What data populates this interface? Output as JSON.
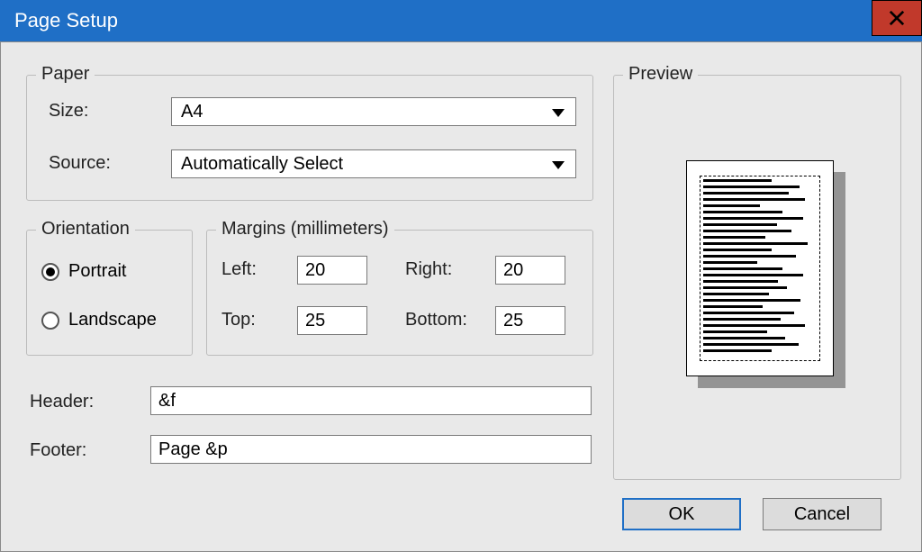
{
  "window": {
    "title": "Page Setup"
  },
  "paper": {
    "legend": "Paper",
    "size_label": "Size:",
    "size_value": "A4",
    "source_label": "Source:",
    "source_value": "Automatically Select"
  },
  "orientation": {
    "legend": "Orientation",
    "portrait_label": "Portrait",
    "landscape_label": "Landscape",
    "selected": "portrait"
  },
  "margins": {
    "legend": "Margins (millimeters)",
    "left_label": "Left:",
    "left_value": "20",
    "right_label": "Right:",
    "right_value": "20",
    "top_label": "Top:",
    "top_value": "25",
    "bottom_label": "Bottom:",
    "bottom_value": "25"
  },
  "header": {
    "label": "Header:",
    "value": "&f"
  },
  "footer": {
    "label": "Footer:",
    "value": "Page &p"
  },
  "preview": {
    "legend": "Preview"
  },
  "buttons": {
    "ok": "OK",
    "cancel": "Cancel"
  }
}
